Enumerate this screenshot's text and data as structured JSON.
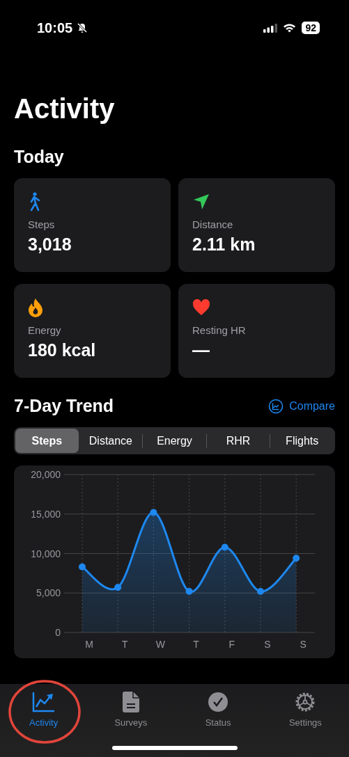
{
  "status_bar": {
    "time": "10:05",
    "battery": "92"
  },
  "title": "Activity",
  "today": {
    "heading": "Today",
    "cards": [
      {
        "kind": "steps",
        "label": "Steps",
        "value": "3,018"
      },
      {
        "kind": "distance",
        "label": "Distance",
        "value": "2.11 km"
      },
      {
        "kind": "energy",
        "label": "Energy",
        "value": "180 kcal"
      },
      {
        "kind": "heart",
        "label": "Resting HR",
        "value": "—"
      }
    ]
  },
  "trend": {
    "heading": "7-Day Trend",
    "compare": "Compare",
    "segments": [
      {
        "label": "Steps",
        "selected": true
      },
      {
        "label": "Distance",
        "selected": false
      },
      {
        "label": "Energy",
        "selected": false
      },
      {
        "label": "RHR",
        "selected": false
      },
      {
        "label": "Flights",
        "selected": false
      }
    ],
    "chart_data": {
      "type": "area",
      "categories": [
        "M",
        "T",
        "W",
        "T",
        "F",
        "S",
        "S"
      ],
      "grid": true,
      "series": [
        {
          "color": "#1e88f0",
          "values": [
            8300,
            5700,
            15200,
            5200,
            10800,
            5200,
            9400
          ]
        }
      ],
      "ylim": [
        0,
        20000
      ],
      "yticks": [
        {
          "value": 0,
          "label": "0"
        },
        {
          "value": 5000,
          "label": "5,000"
        },
        {
          "value": 10000,
          "label": "10,000"
        },
        {
          "value": 15000,
          "label": "15,000"
        },
        {
          "value": 20000,
          "label": "20,000"
        }
      ]
    }
  },
  "tab_bar": [
    {
      "kind": "activity",
      "label": "Activity",
      "selected": true
    },
    {
      "kind": "surveys",
      "label": "Surveys",
      "selected": false
    },
    {
      "kind": "status",
      "label": "Status",
      "selected": false
    },
    {
      "kind": "settings",
      "label": "Settings",
      "selected": false
    }
  ],
  "annotation": {
    "kind": "circle"
  }
}
